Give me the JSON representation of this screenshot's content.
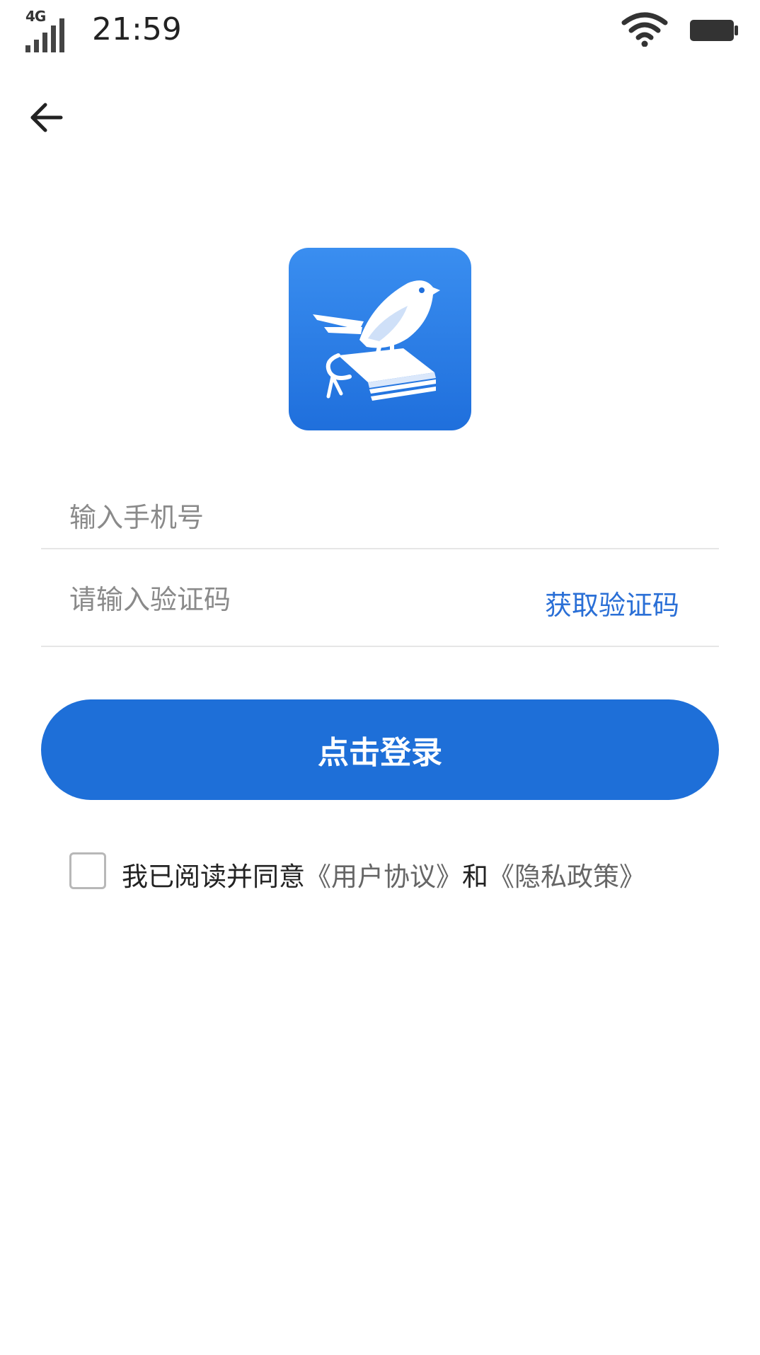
{
  "status_bar": {
    "network": "4G",
    "time": "21:59",
    "icons": [
      "signal-icon",
      "wifi-icon",
      "battery-icon"
    ]
  },
  "nav": {
    "back_icon": "arrow-left-icon"
  },
  "logo": {
    "icon": "bird-on-book-icon",
    "background_color": "#2b7fe6"
  },
  "login_form": {
    "phone_placeholder": "输入手机号",
    "phone_value": "",
    "code_placeholder": "请输入验证码",
    "code_value": "",
    "get_code_label": "获取验证码",
    "login_label": "点击登录"
  },
  "agreement": {
    "checked": false,
    "prefix": "我已阅读并同意",
    "user_agreement_label": "《用户协议》",
    "conjunction": "和",
    "privacy_policy_label": "《隐私政策》"
  },
  "colors": {
    "accent": "#1e6fd8",
    "link": "#2a6fd6",
    "divider": "#e6e6e6",
    "placeholder": "#8a8a8a"
  }
}
